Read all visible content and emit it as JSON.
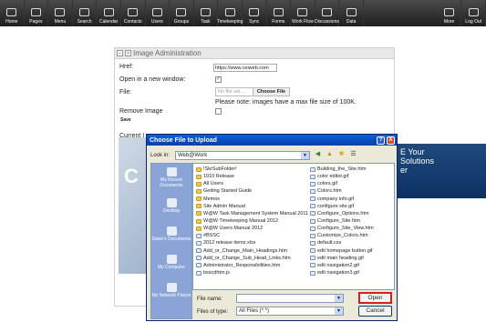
{
  "topbar": {
    "items": [
      {
        "label": "Home",
        "icon": "home-icon"
      },
      {
        "label": "Pages",
        "icon": "pages-icon"
      },
      {
        "label": "Menu",
        "icon": "menu-icon"
      },
      {
        "label": "Search",
        "icon": "search-icon"
      },
      {
        "label": "Calendar",
        "icon": "calendar-icon"
      },
      {
        "label": "Contacts",
        "icon": "contacts-icon"
      },
      {
        "label": "Users",
        "icon": "users-icon"
      },
      {
        "label": "Groups",
        "icon": "groups-icon"
      },
      {
        "label": "Task",
        "icon": "task-icon"
      },
      {
        "label": "Timekeeping",
        "icon": "timekeeping-icon"
      },
      {
        "label": "Sync",
        "icon": "sync-icon"
      },
      {
        "label": "Forms",
        "icon": "forms-icon"
      },
      {
        "label": "Work Flow",
        "icon": "workflow-icon"
      },
      {
        "label": "Discussions",
        "icon": "discussions-icon"
      },
      {
        "label": "Data",
        "icon": "data-icon"
      },
      {
        "label": "More",
        "icon": "more-icon"
      },
      {
        "label": "Log Out",
        "icon": "logout-icon"
      }
    ]
  },
  "panel": {
    "title": "Image Administration",
    "href_label": "Href:",
    "href_value": "https://www.ceiweb.com",
    "new_window_label": "Open in a new window:",
    "file_label": "File:",
    "no_file": "No file sel...",
    "choose_file": "Choose File",
    "note": "Please note: images have a max file size of 100K.",
    "remove_label": "Remove Image",
    "save_label": "Save",
    "current_label": "Current I",
    "side_text": "C",
    "ad_line1": "E Your",
    "ad_line2": "Solutions",
    "ad_line3": "er"
  },
  "dialog": {
    "title": "Choose File to Upload",
    "help": "?",
    "close": "X",
    "look_in_label": "Look in:",
    "look_in_value": "Web@Work",
    "places": [
      {
        "label": "My Recent Documents"
      },
      {
        "label": "Desktop"
      },
      {
        "label": "Dawn's Documents"
      },
      {
        "label": "My Computer"
      },
      {
        "label": "My Network Places"
      }
    ],
    "files_left": [
      {
        "name": "!SkrSubFolder!",
        "kind": "folder"
      },
      {
        "name": "1010 Release",
        "kind": "folder"
      },
      {
        "name": "All Users",
        "kind": "folder"
      },
      {
        "name": "Getting Started Guide",
        "kind": "folder"
      },
      {
        "name": "Memos",
        "kind": "folder"
      },
      {
        "name": "Site Admin Manual",
        "kind": "folder"
      },
      {
        "name": "W@W Task Management System Manual 2011",
        "kind": "folder"
      },
      {
        "name": "W@W Timekeeping Manual 2012",
        "kind": "folder"
      },
      {
        "name": "W@W Users Manual 2012",
        "kind": "folder"
      },
      {
        "name": "#BSSC",
        "kind": "file"
      },
      {
        "name": "2012 release items.xlsx",
        "kind": "file"
      },
      {
        "name": "Add_or_Change_Main_Headings.htm",
        "kind": "file"
      },
      {
        "name": "Add_or_Change_Sub_Head_Links.htm",
        "kind": "file"
      },
      {
        "name": "Administrator_Responsibilities.htm",
        "kind": "file"
      },
      {
        "name": "bsscdhtm.js",
        "kind": "file"
      }
    ],
    "files_right": [
      {
        "name": "Building_the_Site.htm",
        "kind": "file"
      },
      {
        "name": "color editor.gif",
        "kind": "file"
      },
      {
        "name": "colors.gif",
        "kind": "file"
      },
      {
        "name": "Colors.htm",
        "kind": "file"
      },
      {
        "name": "company info.gif",
        "kind": "file"
      },
      {
        "name": "configure site.gif",
        "kind": "file"
      },
      {
        "name": "Configure_Options.htm",
        "kind": "file"
      },
      {
        "name": "Configure_Site.htm",
        "kind": "file"
      },
      {
        "name": "Configure_Site_View.htm",
        "kind": "file"
      },
      {
        "name": "Customize_Colors.htm",
        "kind": "file"
      },
      {
        "name": "default.css",
        "kind": "file"
      },
      {
        "name": "edit homepage button.gif",
        "kind": "file"
      },
      {
        "name": "edit main heading.gif",
        "kind": "file"
      },
      {
        "name": "edit navigation2.gif",
        "kind": "file"
      },
      {
        "name": "edit navigation3.gif",
        "kind": "file"
      }
    ],
    "file_name_label": "File name:",
    "file_name_value": "",
    "files_of_type_label": "Files of type:",
    "files_of_type_value": "All Files (*.*)",
    "open_label": "Open",
    "cancel_label": "Cancel"
  }
}
